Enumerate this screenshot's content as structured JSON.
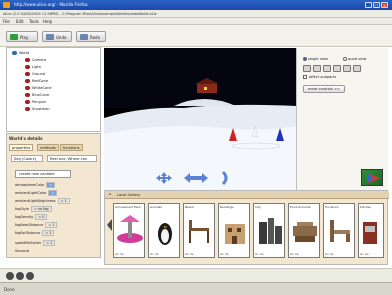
{
  "window": {
    "title": "http://www.alice.org/ - Mozilla Firefox",
    "address": "Alice (2.0 04/05/2005 11:58PM) - C:\\Program Files\\Alice\\example\\Worlds\\dataWorld.a2w"
  },
  "menu": {
    "items": [
      "File",
      "Edit",
      "Tools",
      "Help"
    ]
  },
  "toolbar": {
    "play_label": "Play",
    "undo_label": "Undo",
    "redo_label": "Redo"
  },
  "world_panel": {
    "root_label": "World",
    "items": [
      "Camera",
      "Light",
      "Ground",
      "RedCone",
      "WhiteCone",
      "BlueCone",
      "Penguin",
      "Snowman"
    ]
  },
  "details_panel": {
    "title": "World's details",
    "tabs": [
      "properties",
      "methods",
      "functions"
    ],
    "dropdown_left": "Seq (Colors)",
    "dropdown_right": "Reel one, Where can",
    "create_var_label": "create new variable",
    "props": [
      {
        "name": "atmosphereColor",
        "value": "="
      },
      {
        "name": "ambientLightColor",
        "value": "="
      },
      {
        "name": "ambientLightBrightness",
        "value": "= 1"
      },
      {
        "name": "fogStyle",
        "value": "= no fog"
      },
      {
        "name": "fogDensity",
        "value": "= 0"
      },
      {
        "name": "fogNearDistance",
        "value": "= 1"
      },
      {
        "name": "fogFarDistance",
        "value": "= 1"
      },
      {
        "name": "speedMultiplier",
        "value": "= 1"
      },
      {
        "name": "Seconds",
        "value": ""
      }
    ]
  },
  "right_controls": {
    "radio_single": "single view",
    "radio_quad": "quad view",
    "checkbox_label": "affect subparts",
    "more_controls_label": "more controls >>"
  },
  "gallery": {
    "header_label": "Local Gallery",
    "items": [
      {
        "name": "Amusement Park",
        "foot": "Go Up"
      },
      {
        "name": "Animals",
        "foot": "Go Up"
      },
      {
        "name": "Beach",
        "foot": "Go Up"
      },
      {
        "name": "Buildings",
        "foot": "Go Up"
      },
      {
        "name": "City",
        "foot": "Go Up"
      },
      {
        "name": "Environments",
        "foot": "Go Up"
      },
      {
        "name": "Furniture",
        "foot": "Go Up"
      },
      {
        "name": "Kitchen",
        "foot": "Go Up"
      }
    ]
  },
  "status": {
    "text": "Done"
  },
  "colors": {
    "title_blue": "#1a48a8",
    "cone_red": "#d02020",
    "cone_blue": "#2030c0"
  }
}
